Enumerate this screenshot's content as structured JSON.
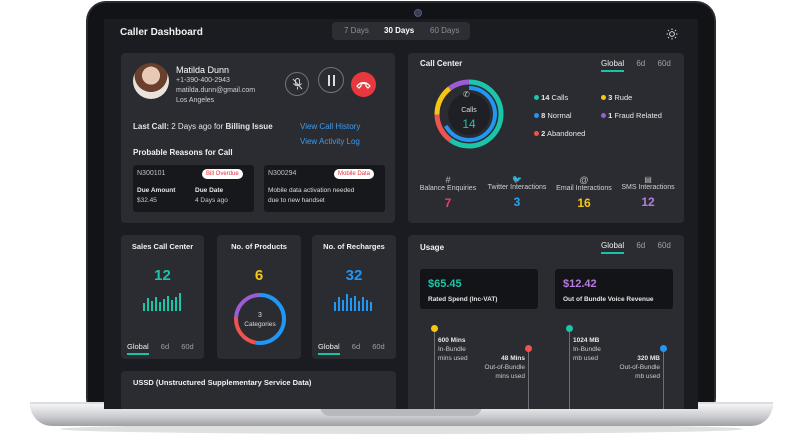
{
  "header": {
    "title": "Caller Dashboard",
    "range_tabs": [
      "7 Days",
      "30 Days",
      "60 Days"
    ],
    "active_range": "30 Days"
  },
  "caller": {
    "name": "Matilda Dunn",
    "phone": "+1-390-400-2943",
    "email": "matilda.dunn@gmail.com",
    "location": "Los Angeles",
    "last_call_prefix": "Last Call:",
    "last_call_when": "2 Days ago for",
    "last_call_reason": "Billing Issue",
    "link_call_history": "View Call History",
    "link_activity_log": "View Activity Log",
    "reasons_title": "Probable Reasons for Call",
    "reasons": [
      {
        "id": "N300101",
        "tag": "Bill Overdue",
        "due_amount_label": "Due Amount",
        "due_amount": "$32.45",
        "due_date_label": "Due Date",
        "due_date": "4 Days ago"
      },
      {
        "id": "N300294",
        "tag": "Mobile Data",
        "desc_line1": "Mobile data activation needed",
        "desc_line2": "due to new handset"
      }
    ]
  },
  "call_center": {
    "title": "Call Center",
    "tabs": [
      "Global",
      "6d",
      "60d"
    ],
    "active_tab": "Global",
    "donut_label": "Calls",
    "donut_value": "14",
    "legend": [
      {
        "count": "14",
        "label": "Calls",
        "color": "#1bc6a8"
      },
      {
        "count": "8",
        "label": "Normal",
        "color": "#2196f3"
      },
      {
        "count": "2",
        "label": "Abandoned",
        "color": "#ef5350"
      },
      {
        "count": "3",
        "label": "Rude",
        "color": "#f5c518"
      },
      {
        "count": "1",
        "label": "Fraud Related",
        "color": "#9c5cd4"
      }
    ],
    "channels": [
      {
        "icon": "hash-icon",
        "glyph": "#",
        "label": "Balance Enquiries",
        "value": "7",
        "color": "#ef3d6b"
      },
      {
        "icon": "twitter-icon",
        "glyph": "🐦",
        "label": "Twitter Interactions",
        "value": "3",
        "color": "#2aa3ef"
      },
      {
        "icon": "at-icon",
        "glyph": "@",
        "label": "Email Interactions",
        "value": "16",
        "color": "#f5c518"
      },
      {
        "icon": "chat-icon",
        "glyph": "▤",
        "label": "SMS Interactions",
        "value": "12",
        "color": "#b77be0"
      }
    ]
  },
  "sales": {
    "title": "Sales Call Center",
    "value": "12",
    "tabs": [
      "Global",
      "6d",
      "60d"
    ],
    "bar_color": "#1bc6a8",
    "bars": [
      0.45,
      0.7,
      0.55,
      0.8,
      0.5,
      0.65,
      0.85,
      0.6,
      0.75,
      1.0
    ]
  },
  "products": {
    "title": "No. of Products",
    "value": "6",
    "donut_value": "3",
    "donut_label": "Categories"
  },
  "recharges": {
    "title": "No. of Recharges",
    "value": "32",
    "tabs": [
      "Global",
      "6d",
      "60d"
    ],
    "bar_color": "#2196f3",
    "bars": [
      0.5,
      0.8,
      0.6,
      0.95,
      0.7,
      0.85,
      0.55,
      0.75,
      0.6,
      0.5
    ]
  },
  "usage": {
    "title": "Usage",
    "tabs": [
      "Global",
      "6d",
      "60d"
    ],
    "active_tab": "Global",
    "rated_spend": "$65.45",
    "rated_spend_label": "Rated Spend (Inc-VAT)",
    "out_of_bundle": "$12.42",
    "out_of_bundle_label": "Out of Bundle Voice Revenue",
    "mins_in": "600 Mins",
    "mins_in_l1": "In-Bundle",
    "mins_in_l2": "mins used",
    "mins_out": "48 Mins",
    "mins_out_l1": "Out-of-Bundle",
    "mins_out_l2": "mins used",
    "mb_in": "1024 MB",
    "mb_in_l1": "In-Bundle",
    "mb_in_l2": "mb used",
    "mb_out": "320 MB",
    "mb_out_l1": "Out-of-Bundle",
    "mb_out_l2": "mb used"
  },
  "ussd": {
    "title": "USSD (Unstructured Supplementary Service Data)"
  }
}
